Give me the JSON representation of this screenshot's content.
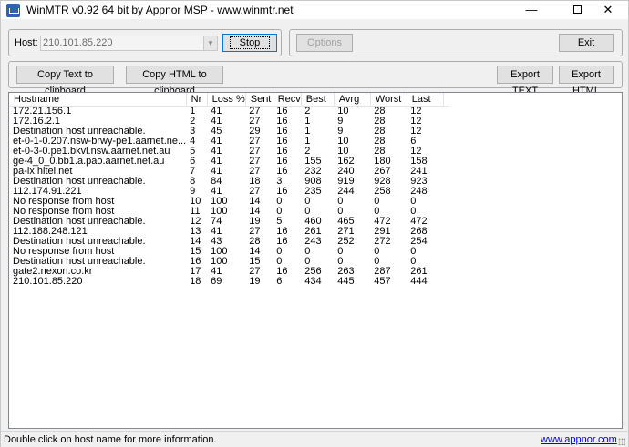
{
  "window": {
    "title": "WinMTR v0.92 64 bit by Appnor MSP - www.winmtr.net",
    "minimize_glyph": "—",
    "close_glyph": "✕"
  },
  "toolbar": {
    "host_label": "Host:",
    "host_value": "210.101.85.220",
    "combo_arrow_glyph": "▼",
    "stop_label": "Stop",
    "options_label": "Options",
    "exit_label": "Exit",
    "copy_text_label": "Copy Text to clipboard",
    "copy_html_label": "Copy HTML to clipboard",
    "export_text_label": "Export TEXT",
    "export_html_label": "Export HTML"
  },
  "table": {
    "columns": [
      "Hostname",
      "Nr",
      "Loss %",
      "Sent",
      "Recv",
      "Best",
      "Avrg",
      "Worst",
      "Last"
    ],
    "rows": [
      [
        "172.21.156.1",
        "1",
        "41",
        "27",
        "16",
        "2",
        "10",
        "28",
        "12"
      ],
      [
        "172.16.2.1",
        "2",
        "41",
        "27",
        "16",
        "1",
        "9",
        "28",
        "12"
      ],
      [
        "Destination host unreachable.",
        "3",
        "45",
        "29",
        "16",
        "1",
        "9",
        "28",
        "12"
      ],
      [
        "et-0-1-0.207.nsw-brwy-pe1.aarnet.ne...",
        "4",
        "41",
        "27",
        "16",
        "1",
        "10",
        "28",
        "6"
      ],
      [
        "et-0-3-0.pe1.bkvl.nsw.aarnet.net.au",
        "5",
        "41",
        "27",
        "16",
        "2",
        "10",
        "28",
        "12"
      ],
      [
        "ge-4_0_0.bb1.a.pao.aarnet.net.au",
        "6",
        "41",
        "27",
        "16",
        "155",
        "162",
        "180",
        "158"
      ],
      [
        "pa-ix.hitel.net",
        "7",
        "41",
        "27",
        "16",
        "232",
        "240",
        "267",
        "241"
      ],
      [
        "Destination host unreachable.",
        "8",
        "84",
        "18",
        "3",
        "908",
        "919",
        "928",
        "923"
      ],
      [
        "112.174.91.221",
        "9",
        "41",
        "27",
        "16",
        "235",
        "244",
        "258",
        "248"
      ],
      [
        "No response from host",
        "10",
        "100",
        "14",
        "0",
        "0",
        "0",
        "0",
        "0"
      ],
      [
        "No response from host",
        "11",
        "100",
        "14",
        "0",
        "0",
        "0",
        "0",
        "0"
      ],
      [
        "Destination host unreachable.",
        "12",
        "74",
        "19",
        "5",
        "460",
        "465",
        "472",
        "472"
      ],
      [
        "112.188.248.121",
        "13",
        "41",
        "27",
        "16",
        "261",
        "271",
        "291",
        "268"
      ],
      [
        "Destination host unreachable.",
        "14",
        "43",
        "28",
        "16",
        "243",
        "252",
        "272",
        "254"
      ],
      [
        "No response from host",
        "15",
        "100",
        "14",
        "0",
        "0",
        "0",
        "0",
        "0"
      ],
      [
        "Destination host unreachable.",
        "16",
        "100",
        "15",
        "0",
        "0",
        "0",
        "0",
        "0"
      ],
      [
        "gate2.nexon.co.kr",
        "17",
        "41",
        "27",
        "16",
        "256",
        "263",
        "287",
        "261"
      ],
      [
        "210.101.85.220",
        "18",
        "69",
        "19",
        "6",
        "434",
        "445",
        "457",
        "444"
      ]
    ]
  },
  "status": {
    "text": "Double click on host name for more information.",
    "link": "www.appnor.com"
  }
}
